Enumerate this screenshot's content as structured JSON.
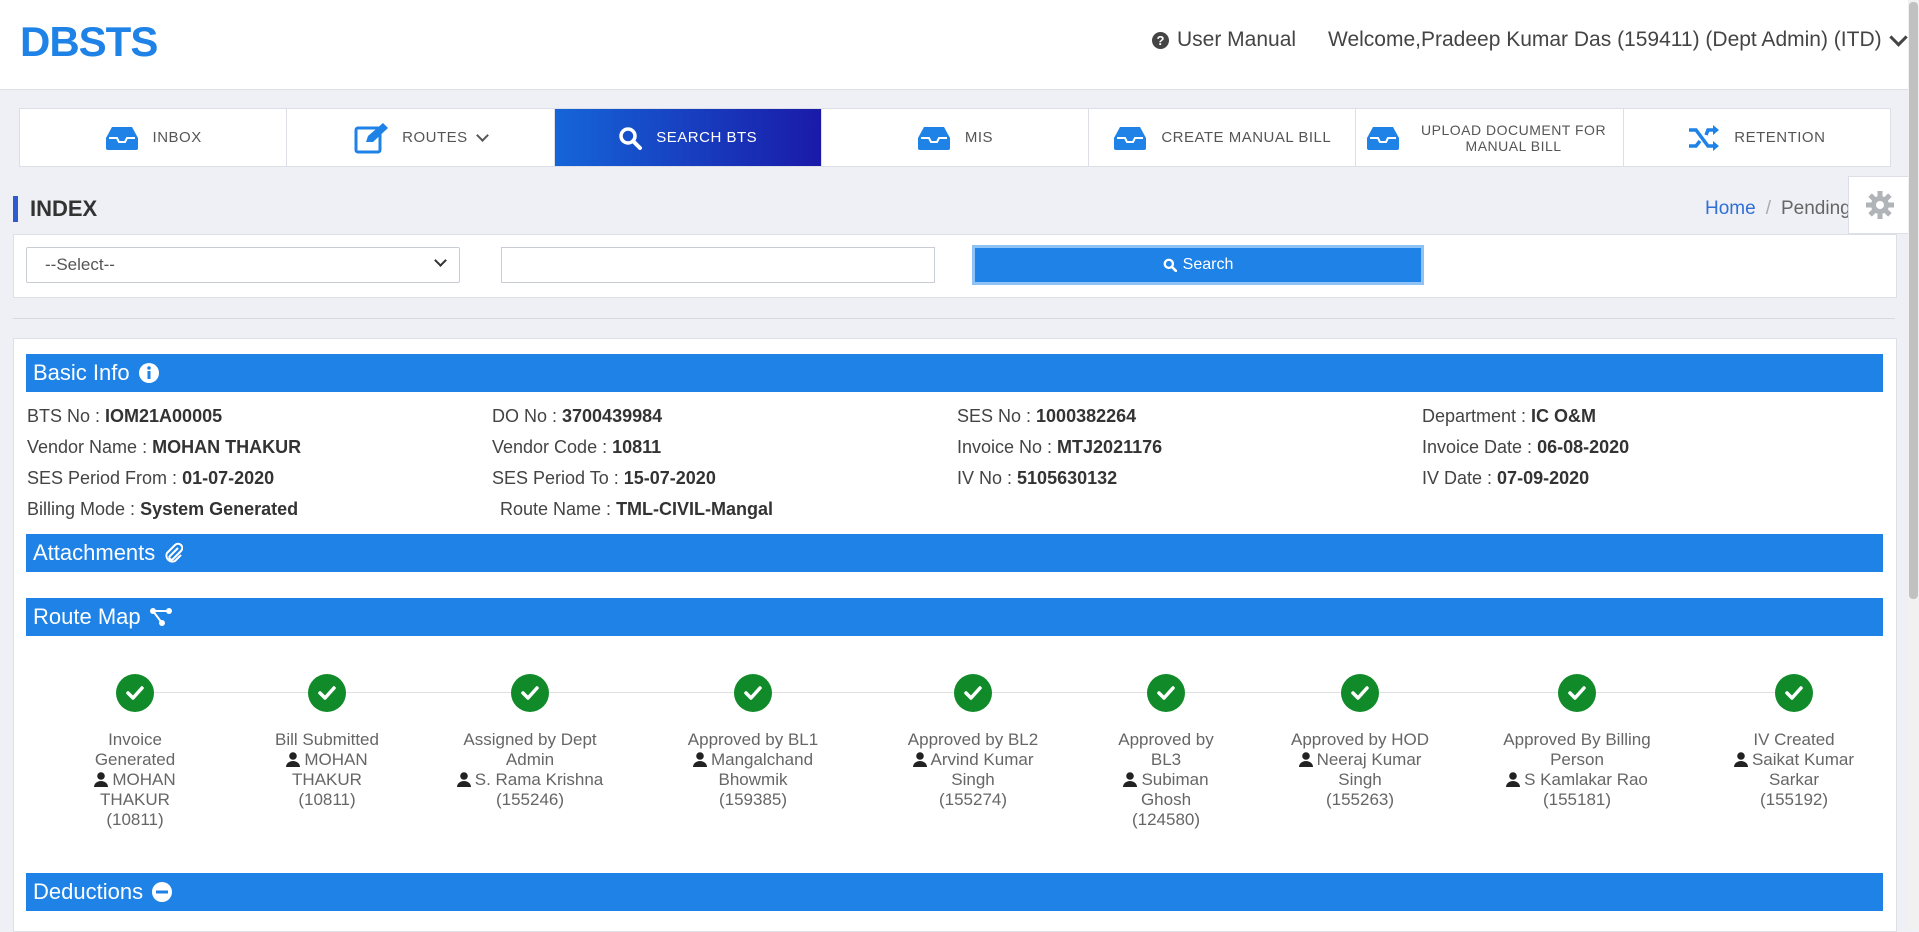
{
  "header": {
    "logo": "DBSTS",
    "user_manual": "User Manual",
    "welcome": "Welcome,Pradeep Kumar Das (159411) (Dept Admin) (ITD)"
  },
  "nav": {
    "items": [
      {
        "label": "INBOX",
        "icon": "inbox-icon"
      },
      {
        "label": "ROUTES",
        "icon": "edit-icon"
      },
      {
        "label": "SEARCH BTS",
        "icon": "search-icon"
      },
      {
        "label": "MIS",
        "icon": "inbox-icon"
      },
      {
        "label": "CREATE MANUAL BILL",
        "icon": "inbox-icon"
      },
      {
        "label": "UPLOAD DOCUMENT FOR MANUAL BILL",
        "icon": "inbox-icon"
      },
      {
        "label": "RETENTION",
        "icon": "shuffle-icon"
      }
    ],
    "active": "SEARCH BTS"
  },
  "page": {
    "title": "INDEX",
    "breadcrumb": {
      "home": "Home",
      "current": "Pending"
    }
  },
  "search": {
    "select_value": "--Select--",
    "input_value": "",
    "button": "Search"
  },
  "basic_info": {
    "title": "Basic Info",
    "rows": [
      [
        {
          "label": "BTS No : ",
          "value": "IOM21A00005"
        },
        {
          "label": "DO No : ",
          "value": "3700439984"
        },
        {
          "label": "SES No : ",
          "value": "1000382264"
        },
        {
          "label": "Department : ",
          "value": "IC O&M"
        }
      ],
      [
        {
          "label": "Vendor Name : ",
          "value": "MOHAN THAKUR"
        },
        {
          "label": "Vendor Code : ",
          "value": "10811"
        },
        {
          "label": "Invoice No : ",
          "value": "MTJ2021176"
        },
        {
          "label": "Invoice Date : ",
          "value": "06-08-2020"
        }
      ],
      [
        {
          "label": "SES Period From : ",
          "value": "01-07-2020"
        },
        {
          "label": "SES Period To : ",
          "value": "15-07-2020"
        },
        {
          "label": "IV No : ",
          "value": "5105630132"
        },
        {
          "label": "IV Date : ",
          "value": "07-09-2020"
        }
      ],
      [
        {
          "label": "Billing Mode : ",
          "value": "System Generated"
        },
        {
          "label": "Route Name : ",
          "value": "TML-CIVIL-Mangal"
        }
      ]
    ]
  },
  "attachments": {
    "title": "Attachments"
  },
  "route_map": {
    "title": "Route Map",
    "steps": [
      {
        "status": "Invoice Generated",
        "person": "MOHAN THAKUR",
        "id": "(10811)"
      },
      {
        "status": "Bill Submitted",
        "person": "MOHAN THAKUR",
        "id": "(10811)"
      },
      {
        "status": "Assigned by Dept Admin",
        "person": "S. Rama Krishna",
        "id": "(155246)"
      },
      {
        "status": "Approved by BL1",
        "person": "Mangalchand Bhowmik",
        "id": "(159385)"
      },
      {
        "status": "Approved by BL2",
        "person": "Arvind Kumar Singh",
        "id": "(155274)"
      },
      {
        "status": "Approved by BL3",
        "person": "Subiman Ghosh",
        "id": "(124580)"
      },
      {
        "status": "Approved by HOD",
        "person": "Neeraj Kumar Singh",
        "id": "(155263)"
      },
      {
        "status": "Approved By Billing Person",
        "person": "S Kamlakar Rao",
        "id": "(155181)"
      },
      {
        "status": "IV Created",
        "person": "Saikat Kumar Sarkar",
        "id": "(155192)"
      }
    ]
  },
  "deductions": {
    "title": "Deductions"
  },
  "colors": {
    "accent": "#1e82e6",
    "active_gradient_start": "#1565d8",
    "active_gradient_end": "#1a1aa8",
    "success": "#118a2a"
  }
}
